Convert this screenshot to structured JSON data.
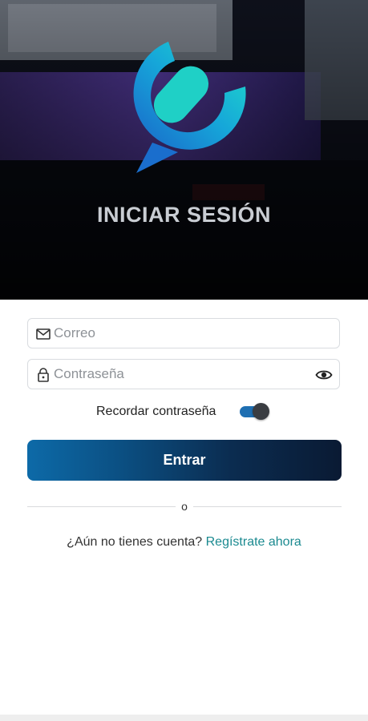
{
  "hero": {
    "title": "INICIAR SESIÓN"
  },
  "form": {
    "email": {
      "placeholder": "Correo",
      "value": ""
    },
    "password": {
      "placeholder": "Contraseña",
      "value": ""
    },
    "remember_label": "Recordar contraseña",
    "remember_on": true,
    "submit_label": "Entrar",
    "divider_text": "o"
  },
  "signup": {
    "prompt": "¿Aún no tienes cuenta?",
    "link": "Regístrate ahora"
  },
  "colors": {
    "accent": "#1f6fb2",
    "link": "#1b8a90",
    "button_start": "#0d6aa8",
    "button_end": "#0a1a33"
  },
  "icons": {
    "logo": "chat-bubble-logo",
    "email": "mail-icon",
    "password": "lock-icon",
    "reveal": "eye-icon"
  }
}
